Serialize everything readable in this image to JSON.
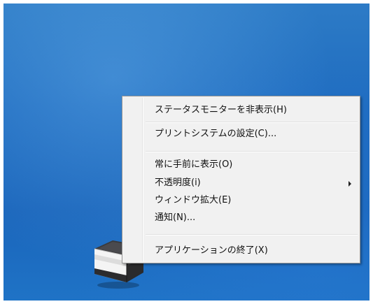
{
  "context_menu": {
    "items": [
      {
        "label": "ステータスモニターを非表示(H)"
      },
      {
        "label": "プリントシステムの設定(C)..."
      },
      {
        "label": "常に手前に表示(O)"
      },
      {
        "label": "不透明度(i)",
        "submenu": true
      },
      {
        "label": "ウィンドウ拡大(E)"
      },
      {
        "label": "通知(N)..."
      },
      {
        "label": "アプリケーションの終了(X)"
      }
    ]
  },
  "desktop": {
    "icon": "printer-icon",
    "colors": {
      "background": "#1f6cc0",
      "menu": "#f1f1f1"
    }
  }
}
